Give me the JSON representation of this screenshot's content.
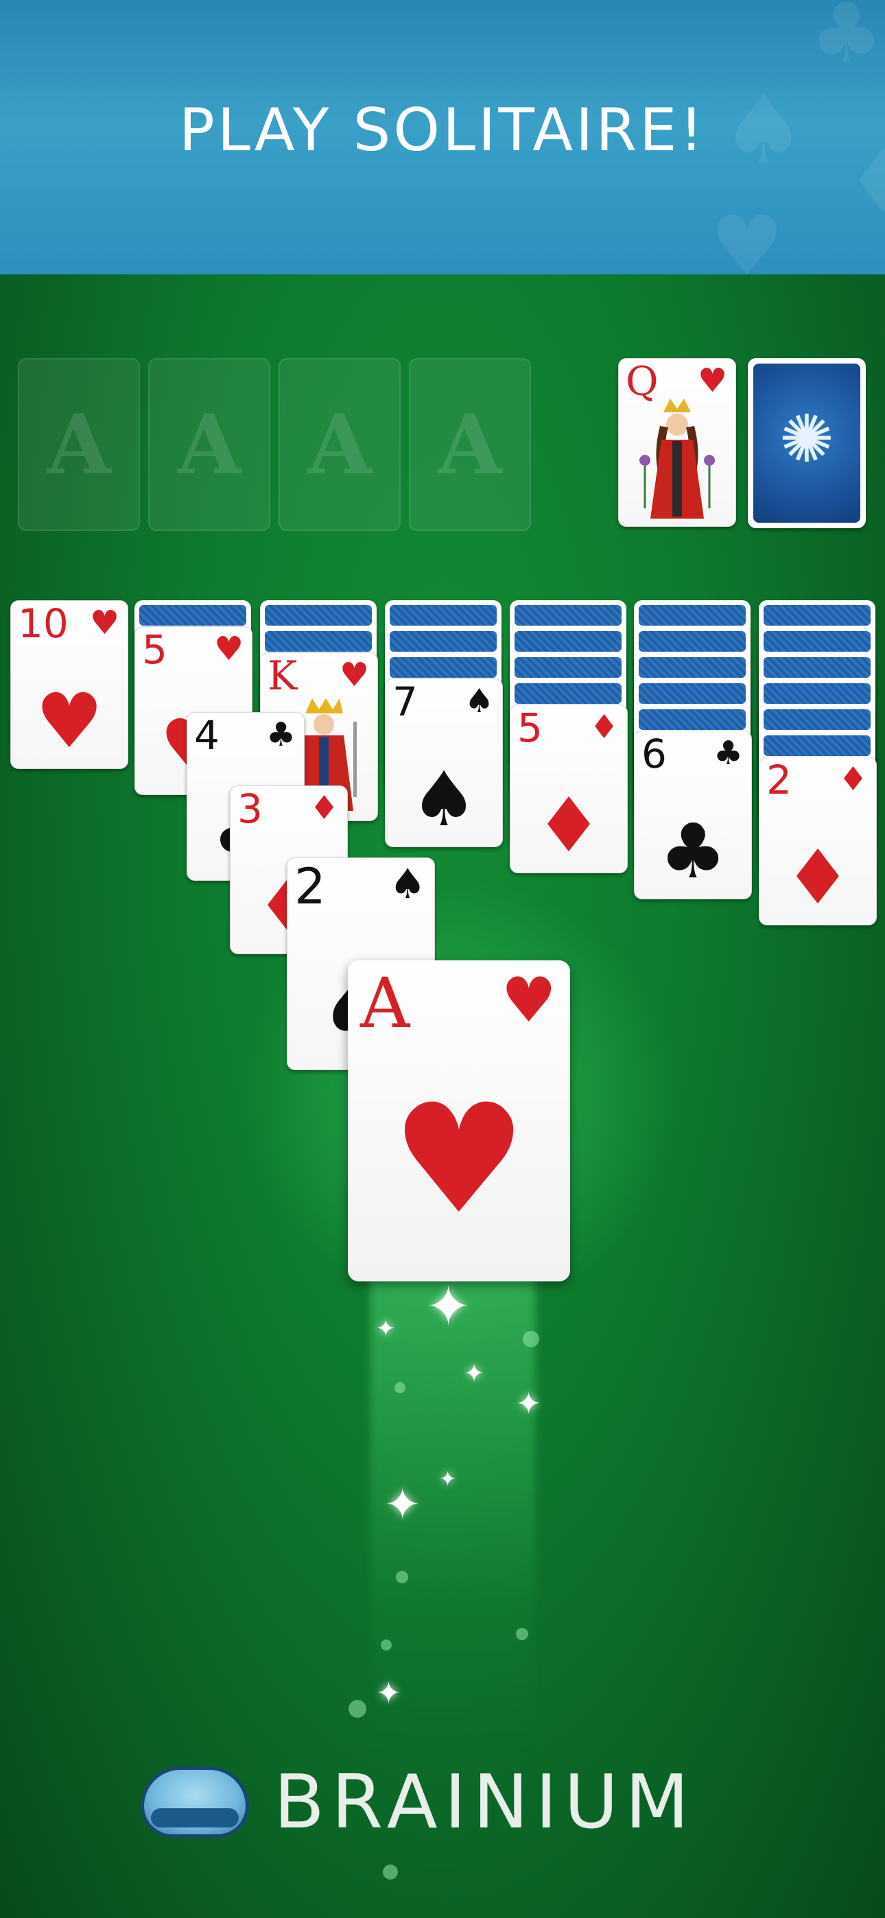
{
  "banner": {
    "title": "PLAY SOLITAIRE!"
  },
  "foundations": [
    {
      "label": "A"
    },
    {
      "label": "A"
    },
    {
      "label": "A"
    },
    {
      "label": "A"
    }
  ],
  "waste": {
    "rank": "Q",
    "suit": "♥",
    "color": "red",
    "figure": "queen"
  },
  "stock": {
    "emblem": "✺"
  },
  "tableau": [
    {
      "facedown": 0,
      "cards": [
        {
          "rank": "10",
          "suit": "♥",
          "color": "red"
        }
      ]
    },
    {
      "facedown": 1,
      "cards": [
        {
          "rank": "5",
          "suit": "♥",
          "color": "red"
        }
      ]
    },
    {
      "facedown": 2,
      "cards": [
        {
          "rank": "K",
          "suit": "♥",
          "color": "red",
          "figure": "king"
        }
      ]
    },
    {
      "facedown": 3,
      "cards": [
        {
          "rank": "7",
          "suit": "♠",
          "color": "black"
        }
      ]
    },
    {
      "facedown": 4,
      "cards": [
        {
          "rank": "5",
          "suit": "♦",
          "color": "red"
        }
      ]
    },
    {
      "facedown": 5,
      "cards": [
        {
          "rank": "6",
          "suit": "♣",
          "color": "black"
        }
      ]
    },
    {
      "facedown": 6,
      "cards": [
        {
          "rank": "2",
          "suit": "♦",
          "color": "red"
        }
      ]
    }
  ],
  "moving_stack": [
    {
      "rank": "4",
      "suit": "♣",
      "color": "black"
    },
    {
      "rank": "3",
      "suit": "♦",
      "color": "red"
    },
    {
      "rank": "2",
      "suit": "♠",
      "color": "black"
    },
    {
      "rank": "A",
      "suit": "♥",
      "color": "red"
    }
  ],
  "brand": {
    "name": "BRAINIUM"
  },
  "colors": {
    "felt": "#0e7a2e",
    "banner": "#3aa0c7",
    "red_suit": "#d61f26",
    "card_back": "#1e5fa8"
  }
}
